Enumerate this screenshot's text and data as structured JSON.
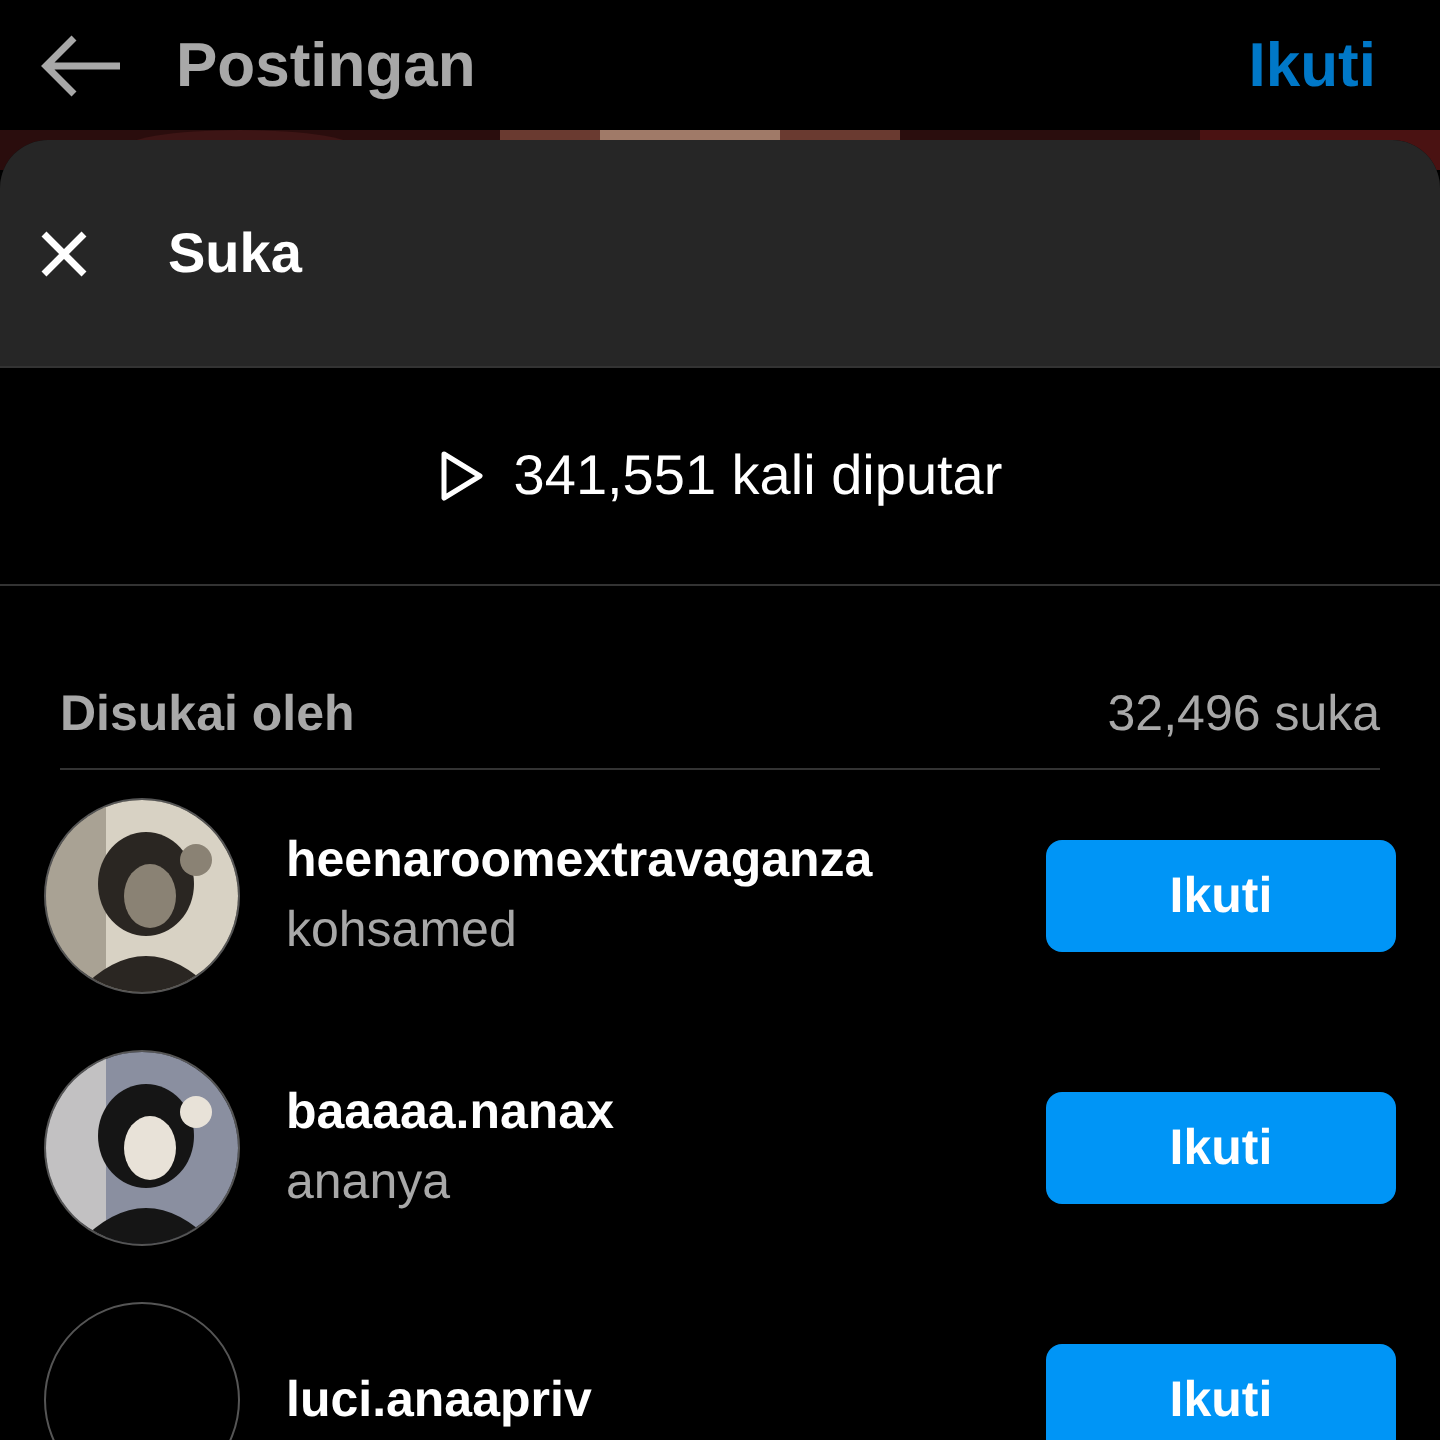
{
  "top_bar": {
    "title": "Postingan",
    "follow_button": "Ikuti"
  },
  "sheet": {
    "title": "Suka",
    "plays": "341,551 kali diputar",
    "liked_by_label": "Disukai oleh",
    "like_count": "32,496 suka"
  },
  "users": [
    {
      "username": "heenaroomextravaganza",
      "name": "kohsamed",
      "button": "Ikuti",
      "kind": "picture"
    },
    {
      "username": "baaaaa.nanax",
      "name": "ananya",
      "button": "Ikuti",
      "kind": "picture"
    },
    {
      "username": "luci.anaapriv",
      "button": "Ikuti",
      "kind": "blank"
    }
  ]
}
